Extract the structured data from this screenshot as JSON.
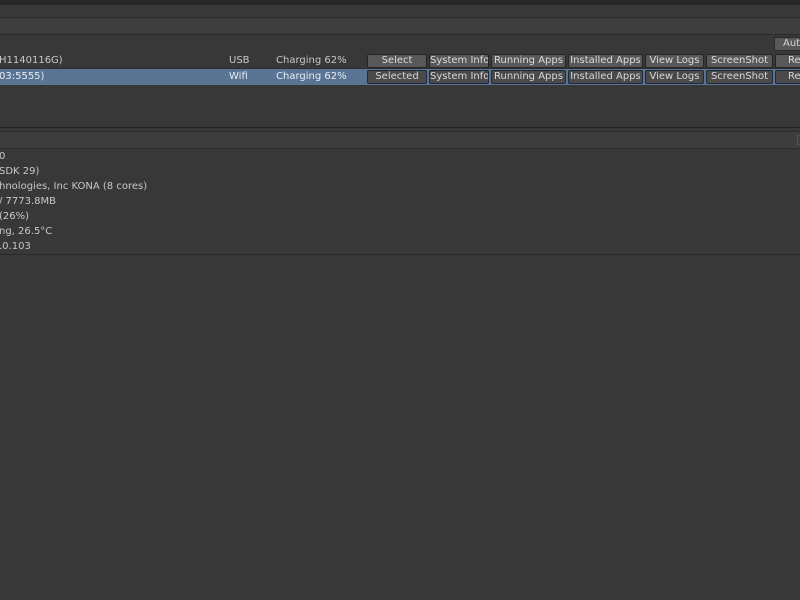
{
  "toolbar": {
    "auto_button": "Auto"
  },
  "devices": [
    {
      "name": "H1140116G)",
      "connection": "USB",
      "status": "Charging 62%",
      "select_label": "Select",
      "buttons": {
        "system_info": "System Info",
        "running_apps": "Running Apps",
        "installed_apps": "Installed Apps",
        "view_logs": "View Logs",
        "screenshot": "ScreenShot",
        "more": "Re"
      }
    },
    {
      "name": "03:5555)",
      "connection": "Wifi",
      "status": "Charging 62%",
      "select_label": "Selected",
      "buttons": {
        "system_info": "System Info",
        "running_apps": "Running Apps",
        "installed_apps": "Installed Apps",
        "view_logs": "View Logs",
        "screenshot": "ScreenShot",
        "more": "Re"
      }
    }
  ],
  "system_info_lines": [
    "0",
    "SDK 29)",
    "hnologies, Inc KONA (8 cores)",
    "/ 7773.8MB",
    " (26%)",
    "ng, 26.5°C",
    ".0.103"
  ]
}
